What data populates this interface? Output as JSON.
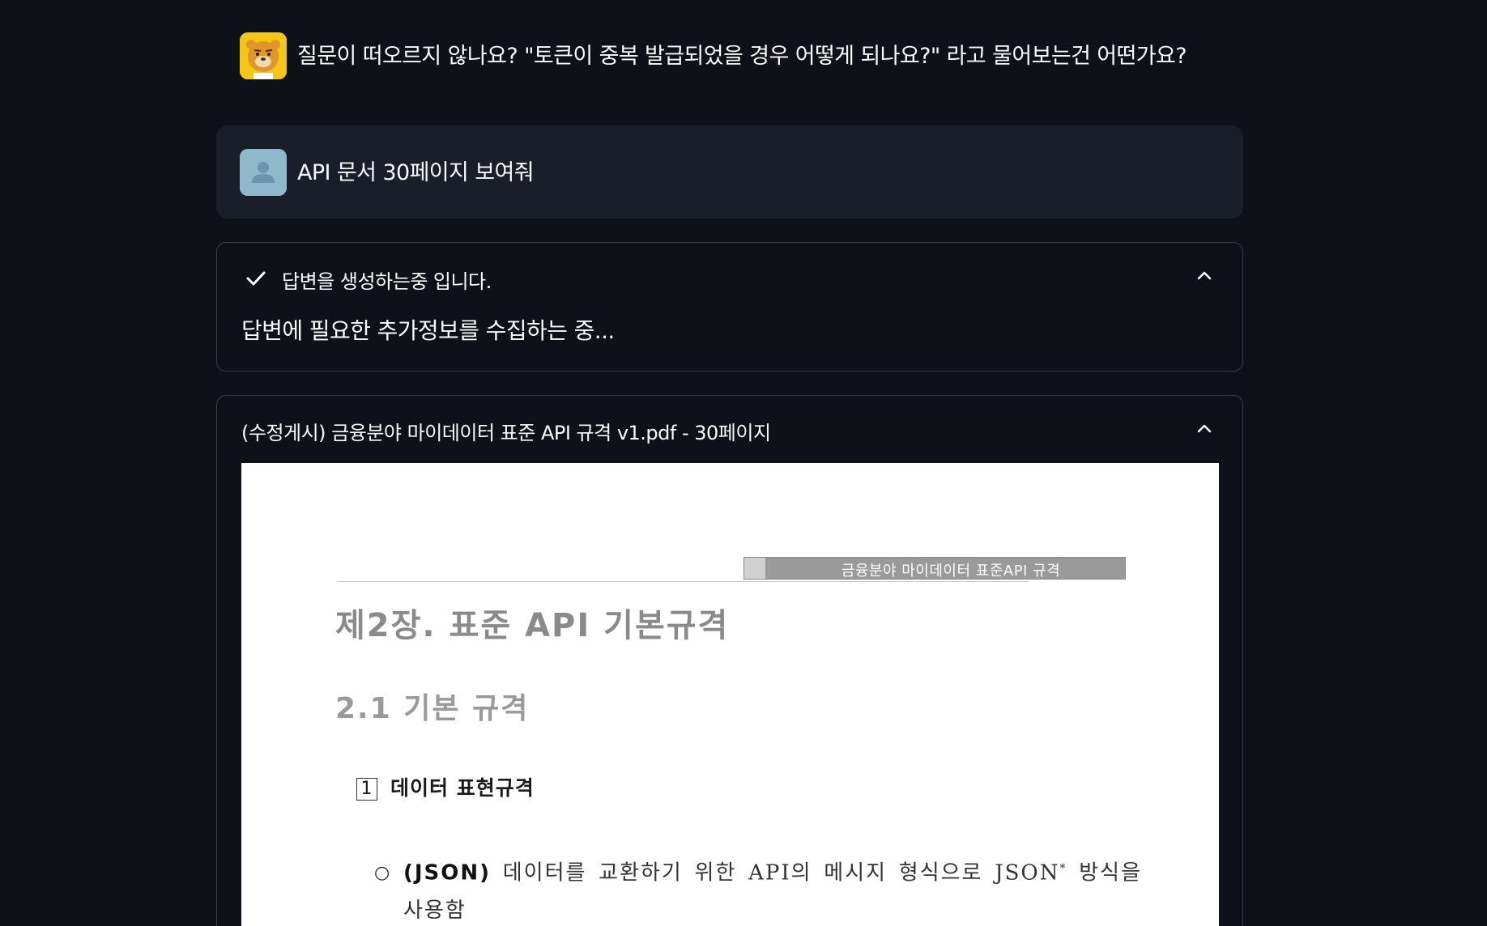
{
  "assistant_message": {
    "text": "질문이 떠오르지 않나요? \"토큰이 중복 발급되었을 경우 어떻게 되나요?\" 라고 물어보는건 어떤가요?"
  },
  "user_message": {
    "text": "API 문서 30페이지 보여줘"
  },
  "status_expander": {
    "title": "답변을 생성하는중 입니다.",
    "body": "답변에 필요한 추가정보를 수집하는 중...",
    "icon": "check-icon"
  },
  "pdf_expander": {
    "title": "(수정게시) 금융분야 마이데이터 표준 API 규격 v1.pdf - 30페이지",
    "page": {
      "header": "금융분야 마이데이터 표준API 규격",
      "h1": "제2장. 표준 API 기본규격",
      "h2": "2.1 기본 규격",
      "h3_number": "1",
      "h3_text": "데이터 표현규격",
      "bullet": "○",
      "para_bold": "(JSON)",
      "para_text": " 데이터를 교환하기 위한 API의 메시지 형식으로 JSON",
      "para_sup": "*",
      "para_tail": " 방식을 사용함"
    }
  },
  "colors": {
    "background": "#0e1117",
    "user_bubble": "#1a1e29",
    "border": "#3a3d48",
    "bot_avatar": "#f5c518",
    "user_avatar": "#8fb8cc"
  }
}
